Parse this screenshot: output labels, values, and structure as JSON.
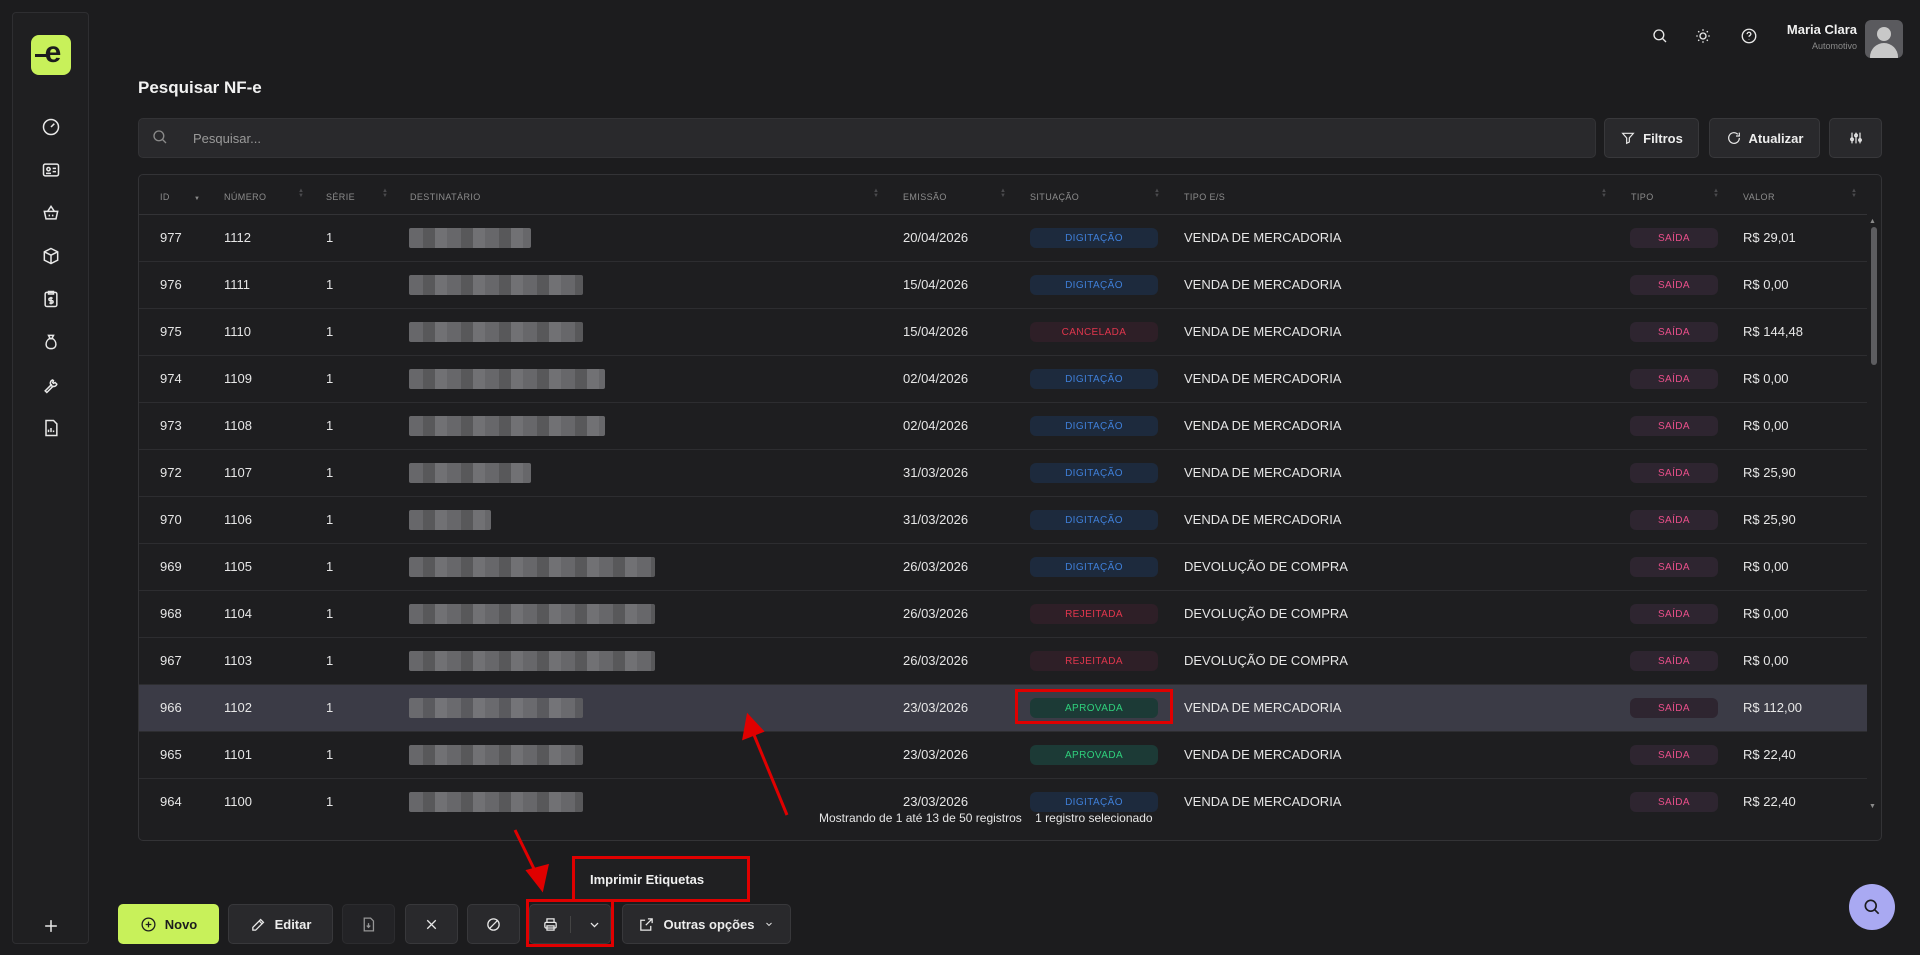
{
  "app": {
    "logo_text": "e"
  },
  "header": {
    "user_name": "Maria Clara",
    "user_role": "Automotivo"
  },
  "page": {
    "title": "Pesquisar NF-e"
  },
  "search": {
    "placeholder": "Pesquisar..."
  },
  "toolbar": {
    "filters_label": "Filtros",
    "refresh_label": "Atualizar"
  },
  "table": {
    "columns": [
      "ID",
      "NÚMERO",
      "SÉRIE",
      "DESTINATÁRIO",
      "EMISSÃO",
      "SITUAÇÃO",
      "TIPO E/S",
      "TIPO",
      "VALOR"
    ],
    "rows": [
      {
        "id": "977",
        "numero": "1112",
        "serie": "1",
        "emissao": "20/04/2026",
        "situacao": "DIGITAÇÃO",
        "tipo_es": "VENDA DE MERCADORIA",
        "tipo": "SAÍDA",
        "valor": "R$ 29,01"
      },
      {
        "id": "976",
        "numero": "1111",
        "serie": "1",
        "emissao": "15/04/2026",
        "situacao": "DIGITAÇÃO",
        "tipo_es": "VENDA DE MERCADORIA",
        "tipo": "SAÍDA",
        "valor": "R$ 0,00"
      },
      {
        "id": "975",
        "numero": "1110",
        "serie": "1",
        "emissao": "15/04/2026",
        "situacao": "CANCELADA",
        "tipo_es": "VENDA DE MERCADORIA",
        "tipo": "SAÍDA",
        "valor": "R$ 144,48"
      },
      {
        "id": "974",
        "numero": "1109",
        "serie": "1",
        "emissao": "02/04/2026",
        "situacao": "DIGITAÇÃO",
        "tipo_es": "VENDA DE MERCADORIA",
        "tipo": "SAÍDA",
        "valor": "R$ 0,00"
      },
      {
        "id": "973",
        "numero": "1108",
        "serie": "1",
        "emissao": "02/04/2026",
        "situacao": "DIGITAÇÃO",
        "tipo_es": "VENDA DE MERCADORIA",
        "tipo": "SAÍDA",
        "valor": "R$ 0,00"
      },
      {
        "id": "972",
        "numero": "1107",
        "serie": "1",
        "emissao": "31/03/2026",
        "situacao": "DIGITAÇÃO",
        "tipo_es": "VENDA DE MERCADORIA",
        "tipo": "SAÍDA",
        "valor": "R$ 25,90"
      },
      {
        "id": "970",
        "numero": "1106",
        "serie": "1",
        "emissao": "31/03/2026",
        "situacao": "DIGITAÇÃO",
        "tipo_es": "VENDA DE MERCADORIA",
        "tipo": "SAÍDA",
        "valor": "R$ 25,90"
      },
      {
        "id": "969",
        "numero": "1105",
        "serie": "1",
        "emissao": "26/03/2026",
        "situacao": "DIGITAÇÃO",
        "tipo_es": "DEVOLUÇÃO DE COMPRA",
        "tipo": "SAÍDA",
        "valor": "R$ 0,00"
      },
      {
        "id": "968",
        "numero": "1104",
        "serie": "1",
        "emissao": "26/03/2026",
        "situacao": "REJEITADA",
        "tipo_es": "DEVOLUÇÃO DE COMPRA",
        "tipo": "SAÍDA",
        "valor": "R$ 0,00"
      },
      {
        "id": "967",
        "numero": "1103",
        "serie": "1",
        "emissao": "26/03/2026",
        "situacao": "REJEITADA",
        "tipo_es": "DEVOLUÇÃO DE COMPRA",
        "tipo": "SAÍDA",
        "valor": "R$ 0,00"
      },
      {
        "id": "966",
        "numero": "1102",
        "serie": "1",
        "emissao": "23/03/2026",
        "situacao": "APROVADA",
        "tipo_es": "VENDA DE MERCADORIA",
        "tipo": "SAÍDA",
        "valor": "R$ 112,00",
        "selected": true
      },
      {
        "id": "965",
        "numero": "1101",
        "serie": "1",
        "emissao": "23/03/2026",
        "situacao": "APROVADA",
        "tipo_es": "VENDA DE MERCADORIA",
        "tipo": "SAÍDA",
        "valor": "R$ 22,40"
      },
      {
        "id": "964",
        "numero": "1100",
        "serie": "1",
        "emissao": "23/03/2026",
        "situacao": "DIGITAÇÃO",
        "tipo_es": "VENDA DE MERCADORIA",
        "tipo": "SAÍDA",
        "valor": "R$ 22,40"
      }
    ],
    "footer_range": "Mostrando de 1 até 13 de 50 registros",
    "footer_selected": "1 registro selecionado"
  },
  "status_colors": {
    "DIGITAÇÃO": {
      "bg": "#1d2a3d",
      "fg": "#3f7fd8"
    },
    "CANCELADA": {
      "bg": "#2e1f27",
      "fg": "#e0364d"
    },
    "REJEITADA": {
      "bg": "#2e1f27",
      "fg": "#e0364d"
    },
    "APROVADA": {
      "bg": "#1c3a36",
      "fg": "#2fd07c"
    },
    "SAÍDA": {
      "bg": "#2e2530",
      "fg": "#e94f8a"
    }
  },
  "bottom": {
    "new_label": "Novo",
    "edit_label": "Editar",
    "more_label": "Outras opções",
    "print_menu_item": "Imprimir Etiquetas"
  },
  "accent_color": "#c8f15a",
  "highlight_color": "#e00000"
}
